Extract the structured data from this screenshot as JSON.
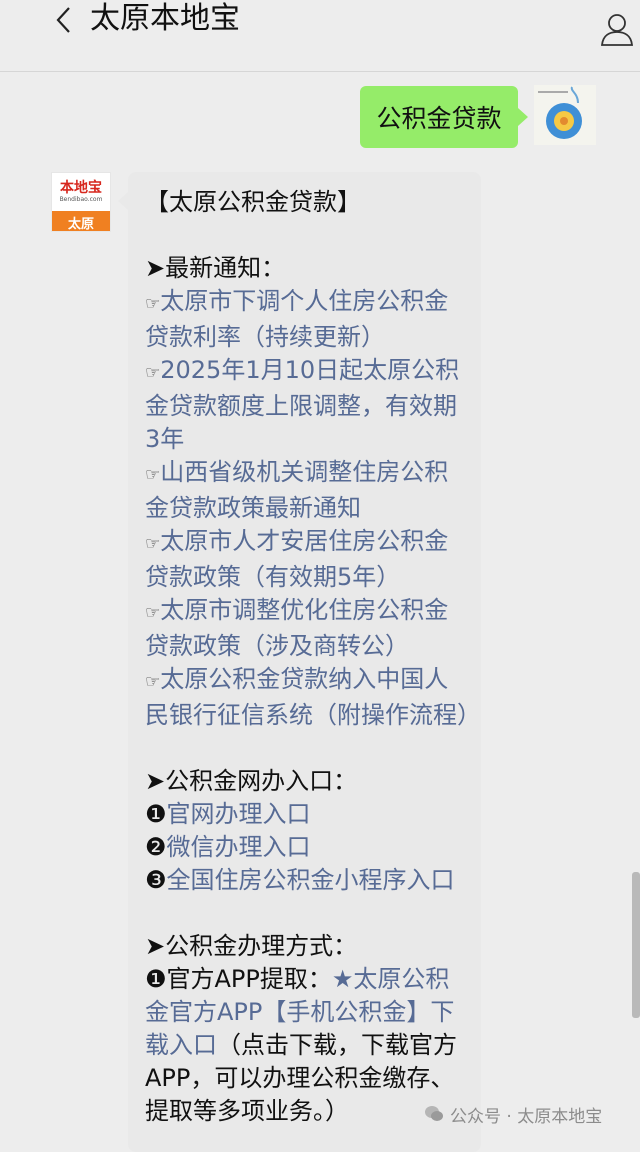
{
  "header": {
    "title": "太原本地宝"
  },
  "colors": {
    "user_bubble": "#95ec69",
    "bot_bubble": "#e9e9e9",
    "link": "#576b95",
    "logo_orange": "#f08021",
    "logo_red": "#d7271e"
  },
  "icons": {
    "back": "chevron-left-icon",
    "profile": "user-icon",
    "wechat": "wechat-icon"
  },
  "user_message": {
    "text": "公积金贷款"
  },
  "bot_avatar": {
    "logo_text": "本地宝",
    "logo_sub": "Bendibao.com",
    "city": "太原"
  },
  "reply": {
    "heading": "【太原公积金贷款】",
    "section1_title": "➤最新通知：",
    "notices": [
      "太原市下调个人住房公积金贷款利率（持续更新）",
      "2025年1月10日起太原公积金贷款额度上限调整，有效期3年",
      "山西省级机关调整住房公积金贷款政策最新通知",
      "太原市人才安居住房公积金贷款政策（有效期5年）",
      "太原市调整优化住房公积金贷款政策（涉及商转公）",
      "太原公积金贷款纳入中国人民银行征信系统（附操作流程）"
    ],
    "hand": "☞",
    "section2_title": "➤公积金网办入口：",
    "entrances": [
      {
        "num": "❶",
        "text": "官网办理入口"
      },
      {
        "num": "❷",
        "text": "微信办理入口"
      },
      {
        "num": "❸",
        "text": "全国住房公积金小程序入口"
      }
    ],
    "section3_title": "➤公积金办理方式：",
    "method1_num": "❶",
    "method1_label": "官方APP提取：",
    "method1_link": "★太原公积金官方APP【手机公积金】下载入口",
    "method1_desc": "（点击下载，下载官方APP，可以办理公积金缴存、提取等多项业务。）"
  },
  "watermark": {
    "text": "公众号 · 太原本地宝"
  }
}
